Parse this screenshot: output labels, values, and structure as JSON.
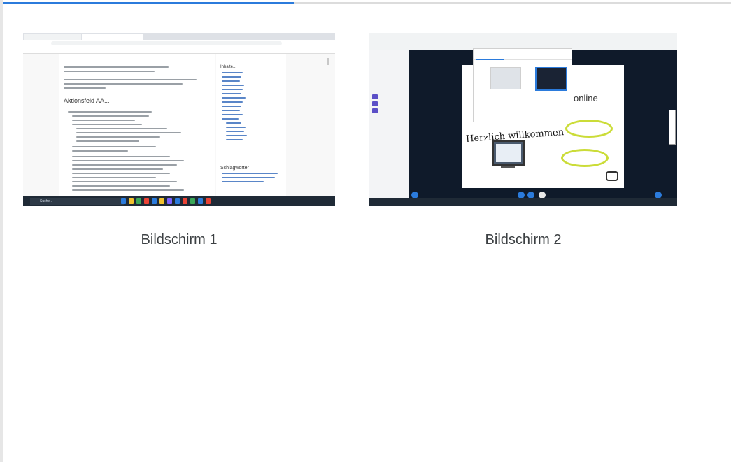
{
  "loading": {
    "progress": 0.4,
    "bar_color": "#2b7bdc"
  },
  "screens": [
    {
      "label": "Bildschirm 1",
      "preview": {
        "heading": "Aktionsfeld AA...",
        "aside_title": "Inhalte...",
        "aside_title2": "Schlagwörter",
        "search_text": "Suche..."
      }
    },
    {
      "label": "Bildschirm 2",
      "preview": {
        "welcome": "Herzlich willkommen",
        "online": "online"
      }
    }
  ],
  "colors": {
    "text": "#3c4043",
    "accent_green": "#cbdc38",
    "dark_bg": "#0f1a2a"
  }
}
